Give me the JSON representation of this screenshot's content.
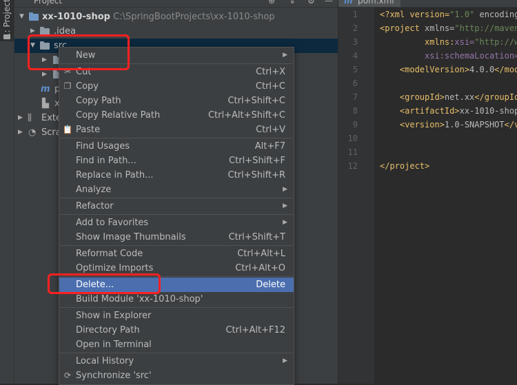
{
  "sidebar": {
    "tab_label": "1: Project"
  },
  "project": {
    "header_title": "Project",
    "tree": [
      {
        "label": "xx-1010-shop",
        "path": "C:\\SpringBootProjects\\xx-1010-shop"
      },
      {
        "label": ".idea"
      },
      {
        "label": "src"
      },
      {
        "label": ""
      },
      {
        "label": ""
      },
      {
        "label": "p"
      },
      {
        "label": "x"
      },
      {
        "label": "Exte"
      },
      {
        "label": "Scra"
      }
    ]
  },
  "editor": {
    "tab_label": "pom.xml",
    "line_numbers": [
      "1",
      "2",
      "3",
      "4",
      "5",
      "6",
      "7",
      "8",
      "9",
      "10",
      "11",
      "12"
    ],
    "lines": [
      {
        "a": "<?xml version=",
        "b": "\"1.0\"",
        "c": " encoding"
      },
      {
        "a": "<project ",
        "b": "xmlns=",
        "c": "\"http://maven"
      },
      {
        "a": "         xmlns:",
        "b": "xsi=",
        "c": "\"http://w"
      },
      {
        "a": "         ",
        "b": "xsi:schemaLocation=",
        "c": ""
      },
      {
        "a": "    <modelVersion>",
        "b": "4.0.0",
        "c": "</mode"
      },
      {
        "a": "",
        "b": "",
        "c": ""
      },
      {
        "a": "    <groupId>",
        "b": "net.xx",
        "c": "</groupId"
      },
      {
        "a": "    <artifactId>",
        "b": "xx-1010-shop",
        "c": ""
      },
      {
        "a": "    <version>",
        "b": "1.0-SNAPSHOT",
        "c": "</v"
      },
      {
        "a": "",
        "b": "",
        "c": ""
      },
      {
        "a": "",
        "b": "",
        "c": ""
      },
      {
        "a": "</project>",
        "b": "",
        "c": ""
      }
    ]
  },
  "context_menu": {
    "items": [
      {
        "label": "New",
        "shortcut": "",
        "submenu": true
      },
      {
        "label": "Cut",
        "shortcut": "Ctrl+X"
      },
      {
        "label": "Copy",
        "shortcut": "Ctrl+C"
      },
      {
        "label": "Copy Path",
        "shortcut": "Ctrl+Shift+C"
      },
      {
        "label": "Copy Relative Path",
        "shortcut": "Ctrl+Alt+Shift+C"
      },
      {
        "label": "Paste",
        "shortcut": "Ctrl+V"
      },
      {
        "label": "Find Usages",
        "shortcut": "Alt+F7"
      },
      {
        "label": "Find in Path...",
        "shortcut": "Ctrl+Shift+F"
      },
      {
        "label": "Replace in Path...",
        "shortcut": "Ctrl+Shift+R"
      },
      {
        "label": "Analyze",
        "shortcut": "",
        "submenu": true
      },
      {
        "label": "Refactor",
        "shortcut": "",
        "submenu": true
      },
      {
        "label": "Add to Favorites",
        "shortcut": "",
        "submenu": true
      },
      {
        "label": "Show Image Thumbnails",
        "shortcut": "Ctrl+Shift+T"
      },
      {
        "label": "Reformat Code",
        "shortcut": "Ctrl+Alt+L"
      },
      {
        "label": "Optimize Imports",
        "shortcut": "Ctrl+Alt+O"
      },
      {
        "label": "Delete...",
        "shortcut": "Delete",
        "highlighted": true
      },
      {
        "label": "Build Module 'xx-1010-shop'",
        "shortcut": ""
      },
      {
        "label": "Show in Explorer",
        "shortcut": ""
      },
      {
        "label": "Directory Path",
        "shortcut": "Ctrl+Alt+F12"
      },
      {
        "label": "Open in Terminal",
        "shortcut": ""
      },
      {
        "label": "Local History",
        "shortcut": "",
        "submenu": true
      },
      {
        "label": "Synchronize 'src'",
        "shortcut": ""
      }
    ]
  },
  "colors": {
    "highlight": "#4b6eaf",
    "annotation": "#ff2020",
    "background": "#3c3f41"
  }
}
